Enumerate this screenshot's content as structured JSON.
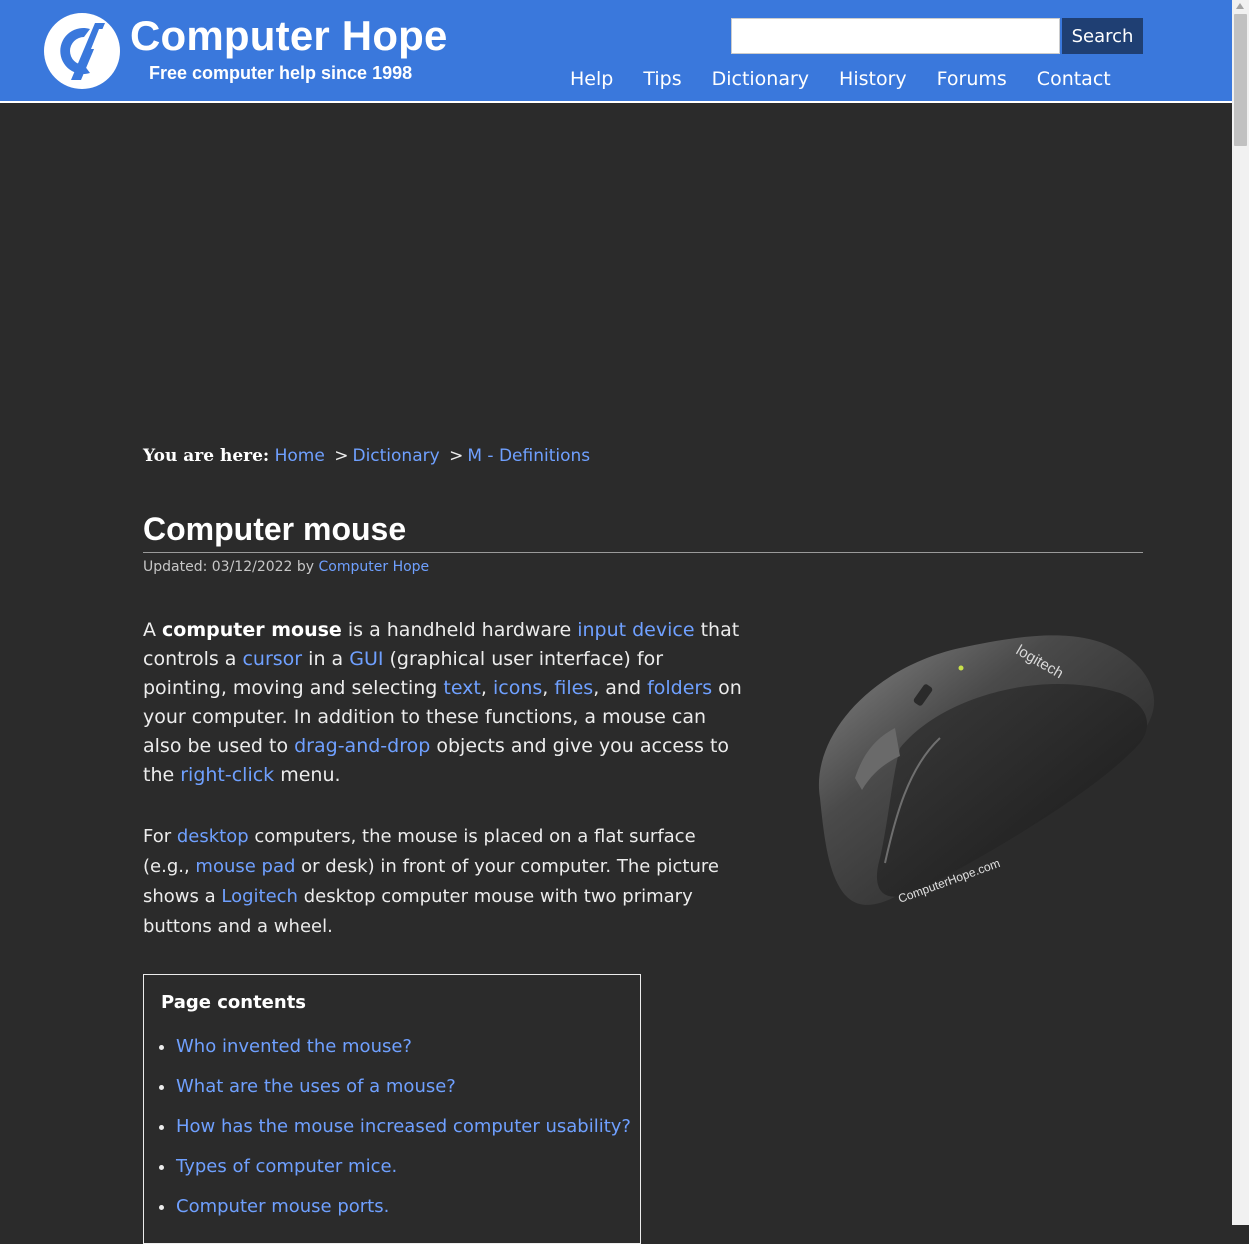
{
  "header": {
    "brand_title": "Computer Hope",
    "brand_tagline": "Free computer help since 1998",
    "search_value": "",
    "search_button": "Search",
    "nav": [
      "Help",
      "Tips",
      "Dictionary",
      "History",
      "Forums",
      "Contact"
    ]
  },
  "breadcrumb": {
    "label": "You are here:",
    "items": [
      "Home",
      "Dictionary",
      "M - Definitions"
    ],
    "separator": ">"
  },
  "article": {
    "title": "Computer mouse",
    "updated_label": "Updated: 03/12/2022 by",
    "author": "Computer Hope",
    "p1": [
      "A ",
      "computer mouse",
      " is a handheld hardware ",
      "input device",
      " that controls a ",
      "cursor",
      " in a ",
      "GUI",
      " (graphical user interface) for pointing, moving and selecting ",
      "text",
      ", ",
      "icons",
      ", ",
      "files",
      ", and ",
      "folders",
      " on your computer. In addition to these functions, a mouse can also be used to ",
      "drag-and-drop",
      " objects and give you access to the ",
      "right-click",
      " menu."
    ],
    "p2": [
      "For ",
      "desktop",
      " computers, the mouse is placed on a flat surface (e.g., ",
      "mouse pad",
      " or desk) in front of your computer. The picture shows a ",
      "Logitech",
      " desktop computer mouse with two primary buttons and a wheel."
    ],
    "image": {
      "brand_text": "logitech",
      "watermark": "ComputerHope.com"
    }
  },
  "toc": {
    "title": "Page contents",
    "items": [
      "Who invented the mouse?",
      "What are the uses of a mouse?",
      "How has the mouse increased computer usability?",
      "Types of computer mice.",
      "Computer mouse ports."
    ]
  },
  "colors": {
    "header_bg": "#3a78dc",
    "page_bg": "#2b2b2b",
    "link": "#6fa0ff",
    "search_button_bg": "#1f3f73"
  }
}
